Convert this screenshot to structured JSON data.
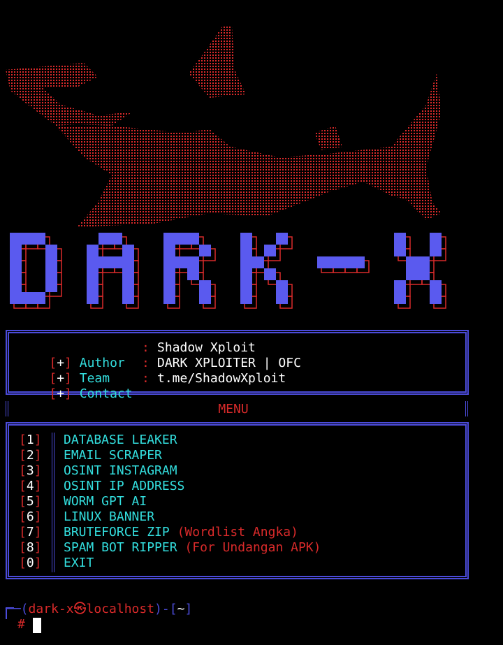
{
  "banner": {
    "art_color": "#d92a2a",
    "logo_text": "DARK-X",
    "logo_fill": "#5a5aef",
    "logo_outline": "#d92a2a"
  },
  "info": {
    "rows": [
      {
        "marker": "+",
        "label": "Author",
        "sep": ":",
        "value": "Shadow Xploit"
      },
      {
        "marker": "+",
        "label": "Team",
        "sep": ":",
        "value": "DARK XPLOITER | OFC"
      },
      {
        "marker": "+",
        "label": "Contact",
        "sep": ":",
        "value": "t.me/ShadowXploit"
      }
    ]
  },
  "menu": {
    "title": "MENU",
    "items": [
      {
        "key": "1",
        "label": "DATABASE LEAKER",
        "note": ""
      },
      {
        "key": "2",
        "label": "EMAIL SCRAPER",
        "note": ""
      },
      {
        "key": "3",
        "label": "OSINT INSTAGRAM",
        "note": ""
      },
      {
        "key": "4",
        "label": "OSINT IP ADDRESS",
        "note": ""
      },
      {
        "key": "5",
        "label": "WORM GPT AI",
        "note": ""
      },
      {
        "key": "6",
        "label": "LINUX BANNER",
        "note": ""
      },
      {
        "key": "7",
        "label": "BRUTEFORCE ZIP",
        "note": "(Wordlist Angka)"
      },
      {
        "key": "8",
        "label": "SPAM BOT RIPPER",
        "note": "(For Undangan APK)"
      },
      {
        "key": "0",
        "label": "EXIT",
        "note": ""
      }
    ]
  },
  "prompt": {
    "user_host": "dark-x㉿localhost",
    "path": "~",
    "symbol": "#"
  },
  "colors": {
    "border": "#4b4bd9",
    "accent_red": "#d92a2a",
    "cyan": "#33dede",
    "white": "#ffffff"
  }
}
